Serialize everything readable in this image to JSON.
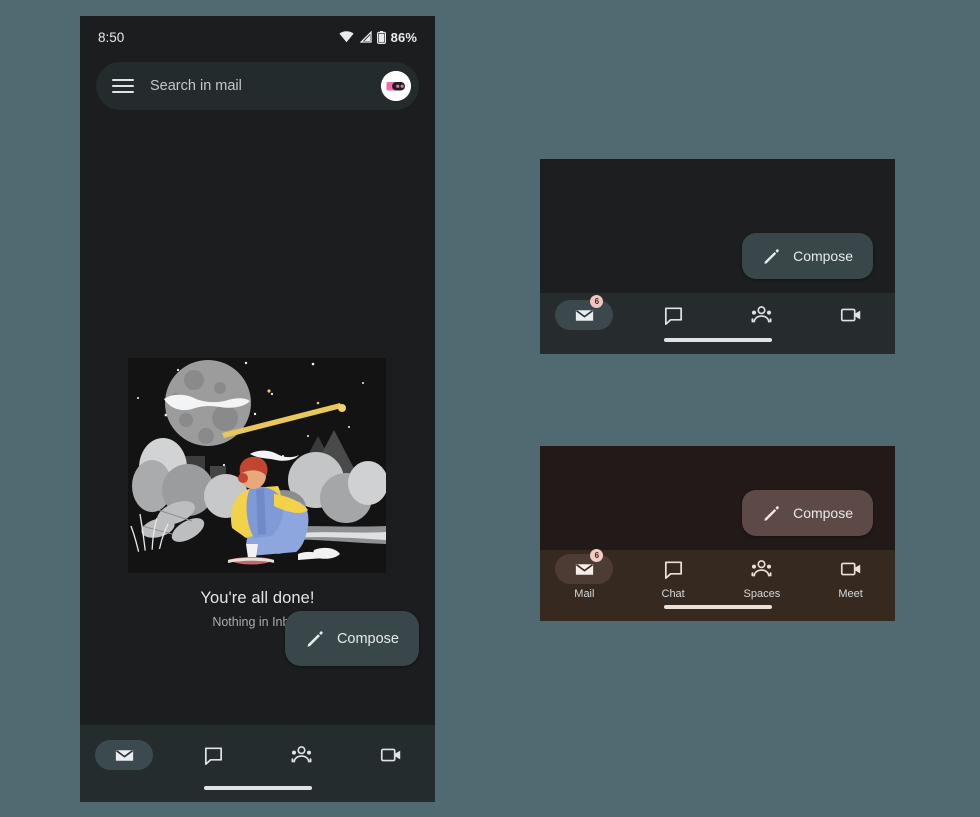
{
  "page": {
    "background_color": "#4f6a70"
  },
  "phone": {
    "status_bar": {
      "time": "8:50",
      "battery_percent": "86%",
      "icons": [
        "wifi-icon",
        "signal-icon",
        "battery-icon"
      ]
    },
    "search": {
      "placeholder": "Search in mail",
      "menu_icon": "hamburger-menu-icon",
      "avatar_label": "account-avatar"
    },
    "empty_state": {
      "title": "You're all done!",
      "subtitle": "Nothing in Inbox",
      "illustration": "night-sky-person-illustration"
    },
    "compose": {
      "label": "Compose",
      "icon": "pencil-icon",
      "background_color": "#39474b"
    },
    "nav": {
      "background_color": "#242c2e",
      "items": [
        {
          "name": "mail",
          "icon": "mail-icon",
          "label": "",
          "active": true,
          "badge": ""
        },
        {
          "name": "chat",
          "icon": "chat-bubble-icon",
          "label": "",
          "active": false,
          "badge": ""
        },
        {
          "name": "spaces",
          "icon": "spaces-people-icon",
          "label": "",
          "active": false,
          "badge": ""
        },
        {
          "name": "meet",
          "icon": "video-camera-icon",
          "label": "",
          "active": false,
          "badge": ""
        }
      ]
    }
  },
  "panel_dark": {
    "background_color": "#1d1e1f",
    "compose": {
      "label": "Compose",
      "icon": "pencil-icon",
      "background_color": "#3a4549"
    },
    "nav": {
      "background_color": "#262b2d",
      "items": [
        {
          "name": "mail",
          "icon": "mail-icon",
          "label": "",
          "active": true,
          "badge": "6"
        },
        {
          "name": "chat",
          "icon": "chat-bubble-icon",
          "label": "",
          "active": false,
          "badge": ""
        },
        {
          "name": "spaces",
          "icon": "spaces-people-icon",
          "label": "",
          "active": false,
          "badge": ""
        },
        {
          "name": "meet",
          "icon": "video-camera-icon",
          "label": "",
          "active": false,
          "badge": ""
        }
      ]
    }
  },
  "panel_brown": {
    "background_color": "#211a18",
    "compose": {
      "label": "Compose",
      "icon": "pencil-icon",
      "background_color": "#5d4a46"
    },
    "nav": {
      "background_color": "#36291f",
      "items": [
        {
          "name": "mail",
          "icon": "mail-icon",
          "label": "Mail",
          "active": true,
          "badge": "6"
        },
        {
          "name": "chat",
          "icon": "chat-bubble-icon",
          "label": "Chat",
          "active": false,
          "badge": ""
        },
        {
          "name": "spaces",
          "icon": "spaces-people-icon",
          "label": "Spaces",
          "active": false,
          "badge": ""
        },
        {
          "name": "meet",
          "icon": "video-camera-icon",
          "label": "Meet",
          "active": false,
          "badge": ""
        }
      ]
    }
  }
}
